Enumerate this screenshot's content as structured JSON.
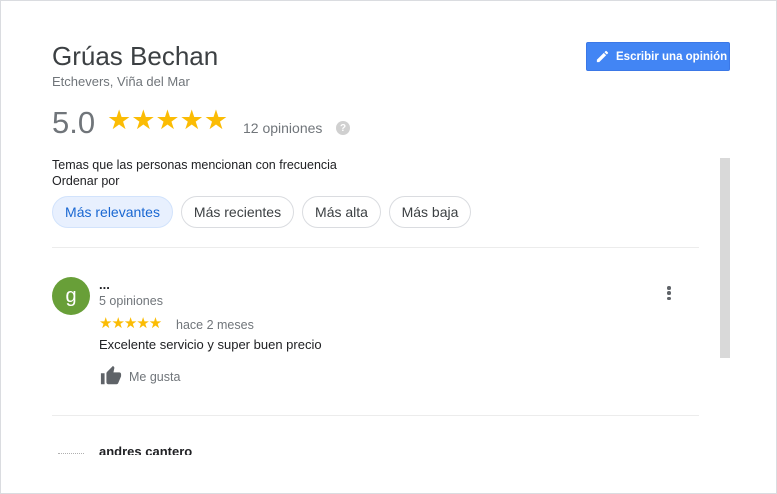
{
  "place": {
    "title": "Grúas Bechan",
    "subtitle": "Etchevers, Viña del Mar"
  },
  "write_review": {
    "label": "Escribir una opinión",
    "icon": "pencil-icon",
    "color": "#4285f4"
  },
  "summary": {
    "rating": "5.0",
    "stars": "★★★★★",
    "reviews_count": "12 opiniones",
    "help_icon": "?"
  },
  "topics_label": "Temas que las personas mencionan con frecuencia",
  "sort_label": "Ordenar por",
  "sort_options": [
    {
      "label": "Más relevantes",
      "active": true
    },
    {
      "label": "Más recientes",
      "active": false
    },
    {
      "label": "Más alta",
      "active": false
    },
    {
      "label": "Más baja",
      "active": false
    }
  ],
  "reviews": [
    {
      "avatar_letter": "g",
      "avatar_color": "#689f38",
      "name": "...",
      "meta": "5 opiniones",
      "stars": "★★★★★",
      "time": "hace 2 meses",
      "text": "Excelente servicio y super buen precio",
      "like_label": "Me gusta"
    },
    {
      "name": "andres cantero"
    }
  ],
  "colors": {
    "star": "#fbbc04",
    "chip_active_bg": "#e8f0fe",
    "chip_active_text": "#1967d2"
  }
}
